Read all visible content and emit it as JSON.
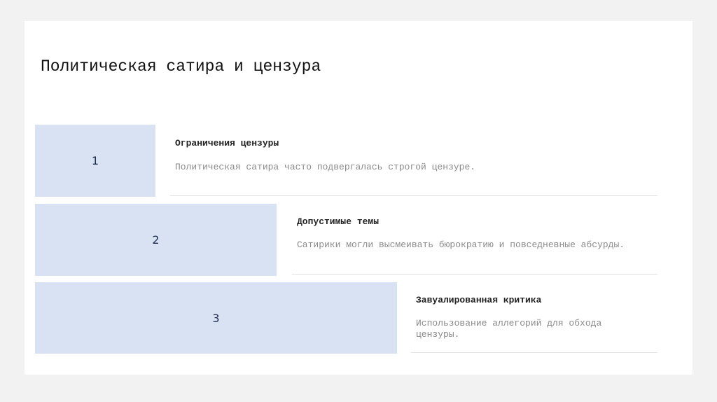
{
  "slide": {
    "title": "Политическая сатира и цензура",
    "steps": [
      {
        "number": "1",
        "heading": "Ограничения цензуры",
        "description": "Политическая сатира часто подвергалась строгой цензуре."
      },
      {
        "number": "2",
        "heading": "Допустимые темы",
        "description": "Сатирики могли высмеивать бюрократию и повседневные абсурды."
      },
      {
        "number": "3",
        "heading": "Завуалированная критика",
        "description": "Использование аллегорий для обхода цензуры."
      }
    ],
    "colors": {
      "step_box": "#d9e2f2",
      "step_number": "#1f2d4d",
      "slide_background": "#ffffff",
      "page_background": "#f2f2f2"
    }
  }
}
